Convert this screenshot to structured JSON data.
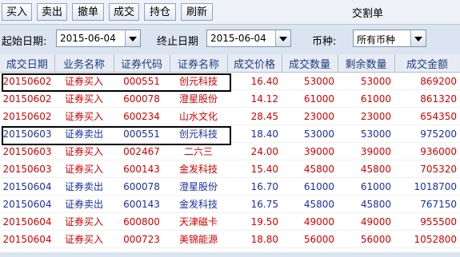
{
  "toolbar": {
    "buttons": [
      "买入",
      "卖出",
      "撤单",
      "成交",
      "持仓",
      "刷新"
    ],
    "title": "交割单"
  },
  "filter": {
    "start_label": "起始日期:",
    "start_value": "2015-06-04",
    "end_label": "终止日期",
    "end_value": "2015-06-04",
    "currency_label": "币种:",
    "currency_value": "所有币种"
  },
  "table": {
    "columns": [
      "成交日期",
      "业务名称",
      "证券代码",
      "证券名称",
      "成交价格",
      "成交数量",
      "剩余数量",
      "成交金额"
    ],
    "rows": [
      {
        "type": "buy",
        "cells": [
          "20150602",
          "证券买入",
          "000551",
          "创元科技",
          "16.40",
          "53000",
          "53000",
          "869200"
        ]
      },
      {
        "type": "buy",
        "cells": [
          "20150602",
          "证券买入",
          "600078",
          "澄星股份",
          "14.12",
          "61000",
          "61000",
          "861320"
        ]
      },
      {
        "type": "buy",
        "cells": [
          "20150602",
          "证券买入",
          "600234",
          "山水文化",
          "28.45",
          "23000",
          "23000",
          "654350"
        ]
      },
      {
        "type": "sell",
        "cells": [
          "20150603",
          "证券卖出",
          "000551",
          "创元科技",
          "18.40",
          "53000",
          "53000",
          "975200"
        ]
      },
      {
        "type": "buy",
        "cells": [
          "20150603",
          "证券买入",
          "002467",
          "二六三",
          "24.00",
          "39000",
          "39000",
          "936000"
        ]
      },
      {
        "type": "buy",
        "cells": [
          "20150603",
          "证券买入",
          "600143",
          "金发科技",
          "15.40",
          "45800",
          "45800",
          "705320"
        ]
      },
      {
        "type": "sell",
        "cells": [
          "20150604",
          "证券卖出",
          "600078",
          "澄星股份",
          "16.70",
          "61000",
          "61000",
          "1018700"
        ]
      },
      {
        "type": "sell",
        "cells": [
          "20150604",
          "证券卖出",
          "600143",
          "金发科技",
          "16.75",
          "45800",
          "45800",
          "767150"
        ]
      },
      {
        "type": "buy",
        "cells": [
          "20150604",
          "证券买入",
          "600800",
          "天津磁卡",
          "19.50",
          "49000",
          "49000",
          "955500"
        ]
      },
      {
        "type": "buy",
        "cells": [
          "20150604",
          "证券买入",
          "000723",
          "美锦能源",
          "18.80",
          "56000",
          "56000",
          "1052800"
        ]
      }
    ]
  },
  "colors": {
    "buy": "#d40000",
    "sell": "#1a2fa5",
    "header_text": "#1e3c80"
  }
}
